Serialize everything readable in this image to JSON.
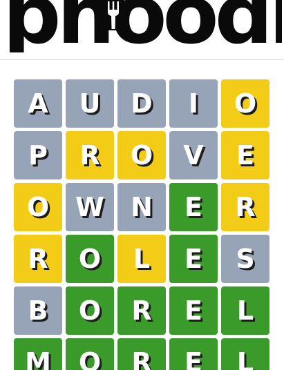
{
  "app": {
    "logo_text": "pnoodle",
    "logo_icon": "fork-icon"
  },
  "colors": {
    "absent": "#97a4b8",
    "present": "#f2cc16",
    "correct": "#3a9a2a",
    "logo": "#0a0a0a"
  },
  "board": {
    "rows": [
      {
        "letters": [
          "A",
          "U",
          "D",
          "I",
          "O"
        ],
        "states": [
          "absent",
          "absent",
          "absent",
          "absent",
          "present"
        ]
      },
      {
        "letters": [
          "P",
          "R",
          "O",
          "V",
          "E"
        ],
        "states": [
          "absent",
          "present",
          "present",
          "absent",
          "present"
        ]
      },
      {
        "letters": [
          "O",
          "W",
          "N",
          "E",
          "R"
        ],
        "states": [
          "present",
          "absent",
          "absent",
          "correct",
          "present"
        ]
      },
      {
        "letters": [
          "R",
          "O",
          "L",
          "E",
          "S"
        ],
        "states": [
          "present",
          "correct",
          "present",
          "correct",
          "absent"
        ]
      },
      {
        "letters": [
          "B",
          "O",
          "R",
          "E",
          "L"
        ],
        "states": [
          "absent",
          "correct",
          "correct",
          "correct",
          "correct"
        ]
      },
      {
        "letters": [
          "M",
          "O",
          "R",
          "E",
          "L"
        ],
        "states": [
          "correct",
          "correct",
          "correct",
          "correct",
          "correct"
        ]
      }
    ]
  }
}
